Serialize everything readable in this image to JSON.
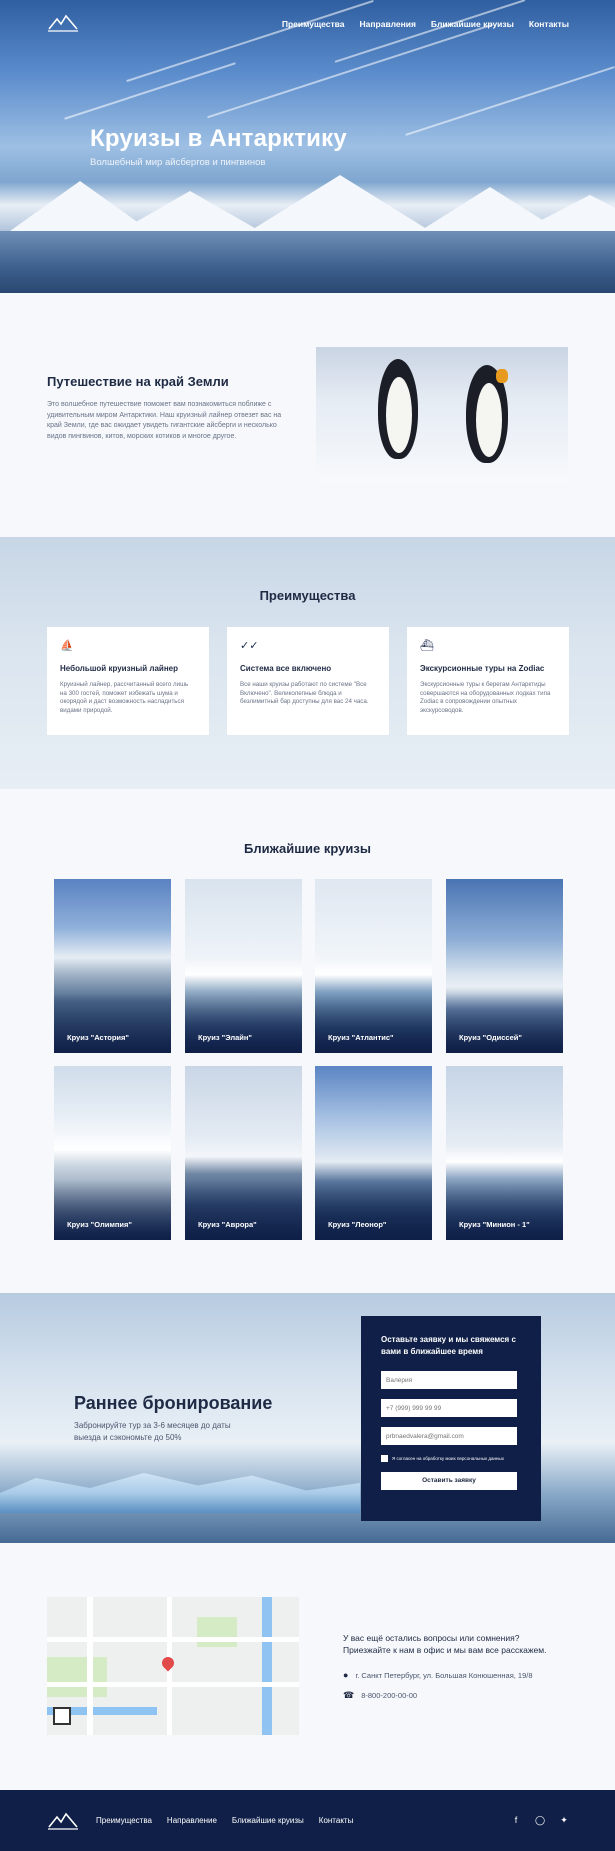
{
  "header": {
    "nav": [
      "Преимущества",
      "Направления",
      "Ближайшие круизы",
      "Контакты"
    ]
  },
  "hero": {
    "title": "Круизы в Антарктику",
    "subtitle": "Волшебный мир айсбергов и пингвинов"
  },
  "intro": {
    "title": "Путешествие на край Земли",
    "text": "Это волшебное путешествие поможет вам познакомиться поближе с удивительным миром Антарктики. Наш круизный лайнер отвезет вас на край Земли, где вас ожидает увидеть гигантские айсберги и несколько видов пингвинов, китов, морских котиков и многое другое."
  },
  "advantages": {
    "title": "Преимущества",
    "cards": [
      {
        "icon": "ship-icon",
        "title": "Небольшой круизный лайнер",
        "text": "Круизный лайнер, рассчитанный всего лишь на 300 гостей, поможет избежать шума и окорядой и даст возможность насладиться видами природой."
      },
      {
        "icon": "check-icon",
        "title": "Система все включено",
        "text": "Все наши круизы работают по системе \"Все Включено\". Великолепные блюда и безлимитный бар доступны для вас 24 часа."
      },
      {
        "icon": "boat-icon",
        "title": "Экскурсионные туры на Zodiac",
        "text": "Экскурсионные туры к берегам Антарктиды совершаются на оборудованных лодках типа Zodiac в сопровождении опытных экскурсоводов."
      }
    ]
  },
  "cruises": {
    "title": "Ближайшие круизы",
    "items": [
      "Круиз \"Астория\"",
      "Круиз \"Элайн\"",
      "Круиз \"Атлантис\"",
      "Круиз \"Одиссей\"",
      "Круиз \"Олимпия\"",
      "Круиз \"Аврора\"",
      "Круиз \"Леонор\"",
      "Круиз \"Минион - 1\""
    ]
  },
  "booking": {
    "title": "Раннее бронирование",
    "subtitle": "Забронируйте тур за 3-6 месяцев до даты выезда и сэкономьте до 50%",
    "form_title": "Оставьте заявку и мы свяжемся с вами в ближайшее время",
    "name_placeholder": "Валерия",
    "phone_placeholder": "+7 (999) 999 99 99",
    "email_placeholder": "prbnaedvalera@gmail.com",
    "consent": "Я согласен на обработку моих персональных данных",
    "submit": "Оставить заявку"
  },
  "contacts": {
    "question": "У вас ещё остались вопросы или сомнения? Приезжайте к нам в офис и мы вам все расскажем.",
    "address": "г. Санкт Петербург, ул. Большая Конюшенная, 19/8",
    "phone": "8-800-200-00-00"
  },
  "footer": {
    "nav": [
      "Преимущества",
      "Направление",
      "Ближайшие круизы",
      "Контакты"
    ],
    "social": [
      "facebook-icon",
      "instagram-icon",
      "twitter-icon"
    ]
  }
}
